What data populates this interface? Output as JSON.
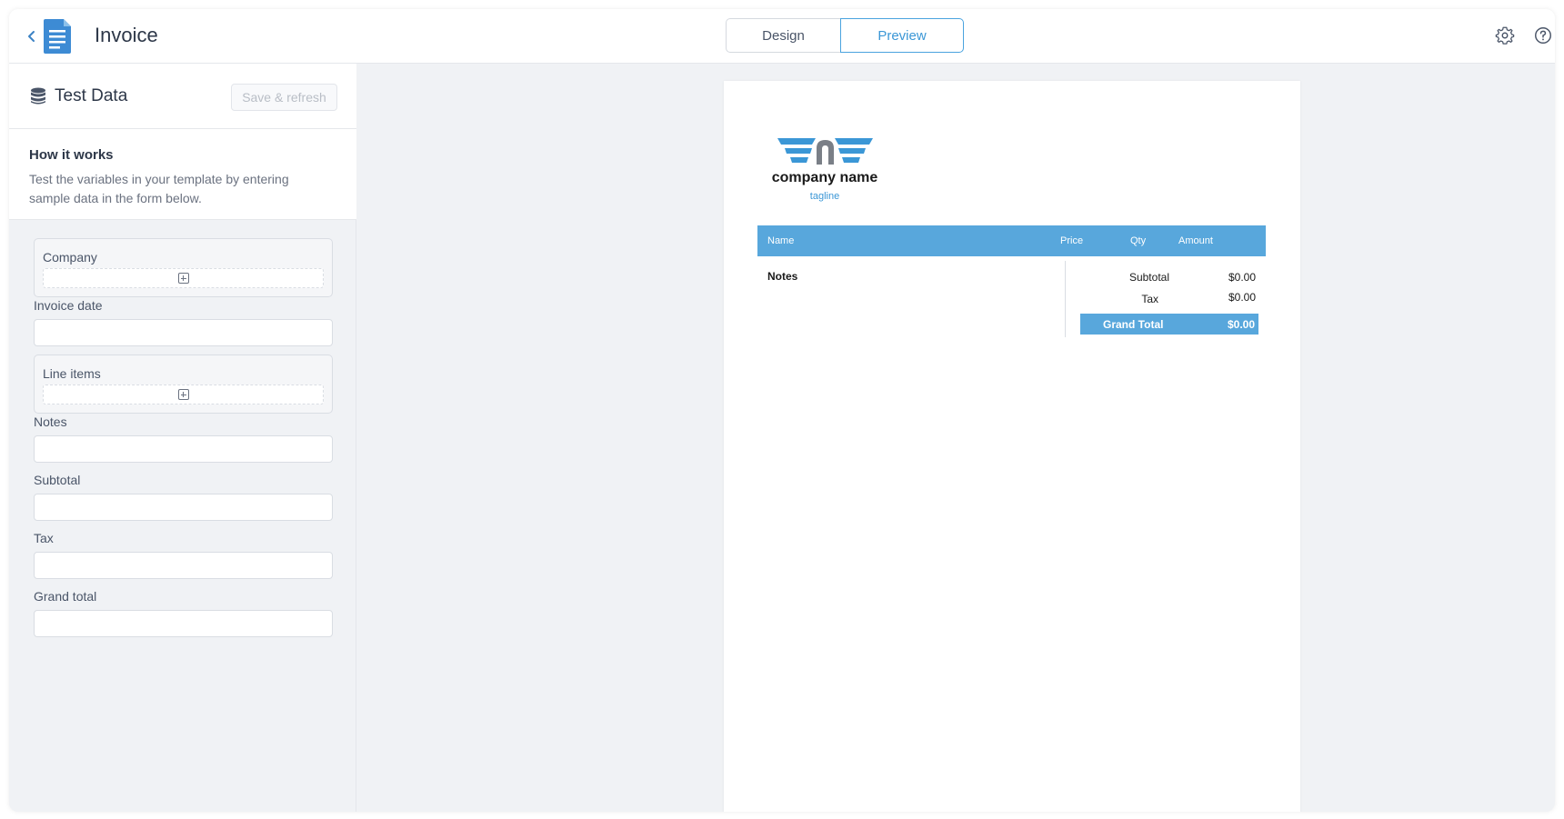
{
  "header": {
    "title": "Invoice",
    "tabs": [
      {
        "label": "Design",
        "active": false
      },
      {
        "label": "Preview",
        "active": true
      }
    ],
    "icons": [
      "back-chevron-icon",
      "document-icon",
      "settings-gear-icon",
      "help-icon"
    ]
  },
  "sidebar": {
    "title": "Test Data",
    "save_label": "Save & refresh",
    "how_title": "How it works",
    "how_text": "Test the variables in your template by entering sample data in the form below.",
    "fields": {
      "company": "Company",
      "invoice_date": "Invoice date",
      "line_items": "Line items",
      "notes": "Notes",
      "subtotal": "Subtotal",
      "tax": "Tax",
      "grand_total": "Grand total"
    }
  },
  "preview": {
    "company_name": "company name",
    "tagline": "tagline",
    "table_headers": {
      "name": "Name",
      "price": "Price",
      "qty": "Qty",
      "amount": "Amount"
    },
    "notes_label": "Notes",
    "subtotal_label": "Subtotal",
    "subtotal_value": "$0.00",
    "tax_label": "Tax",
    "tax_value": "$0.00",
    "grand_total_label": "Grand Total",
    "grand_total_value": "$0.00"
  },
  "colors": {
    "accent": "#58a7dc",
    "tab_active": "#3b97d6",
    "background": "#f0f2f5"
  }
}
